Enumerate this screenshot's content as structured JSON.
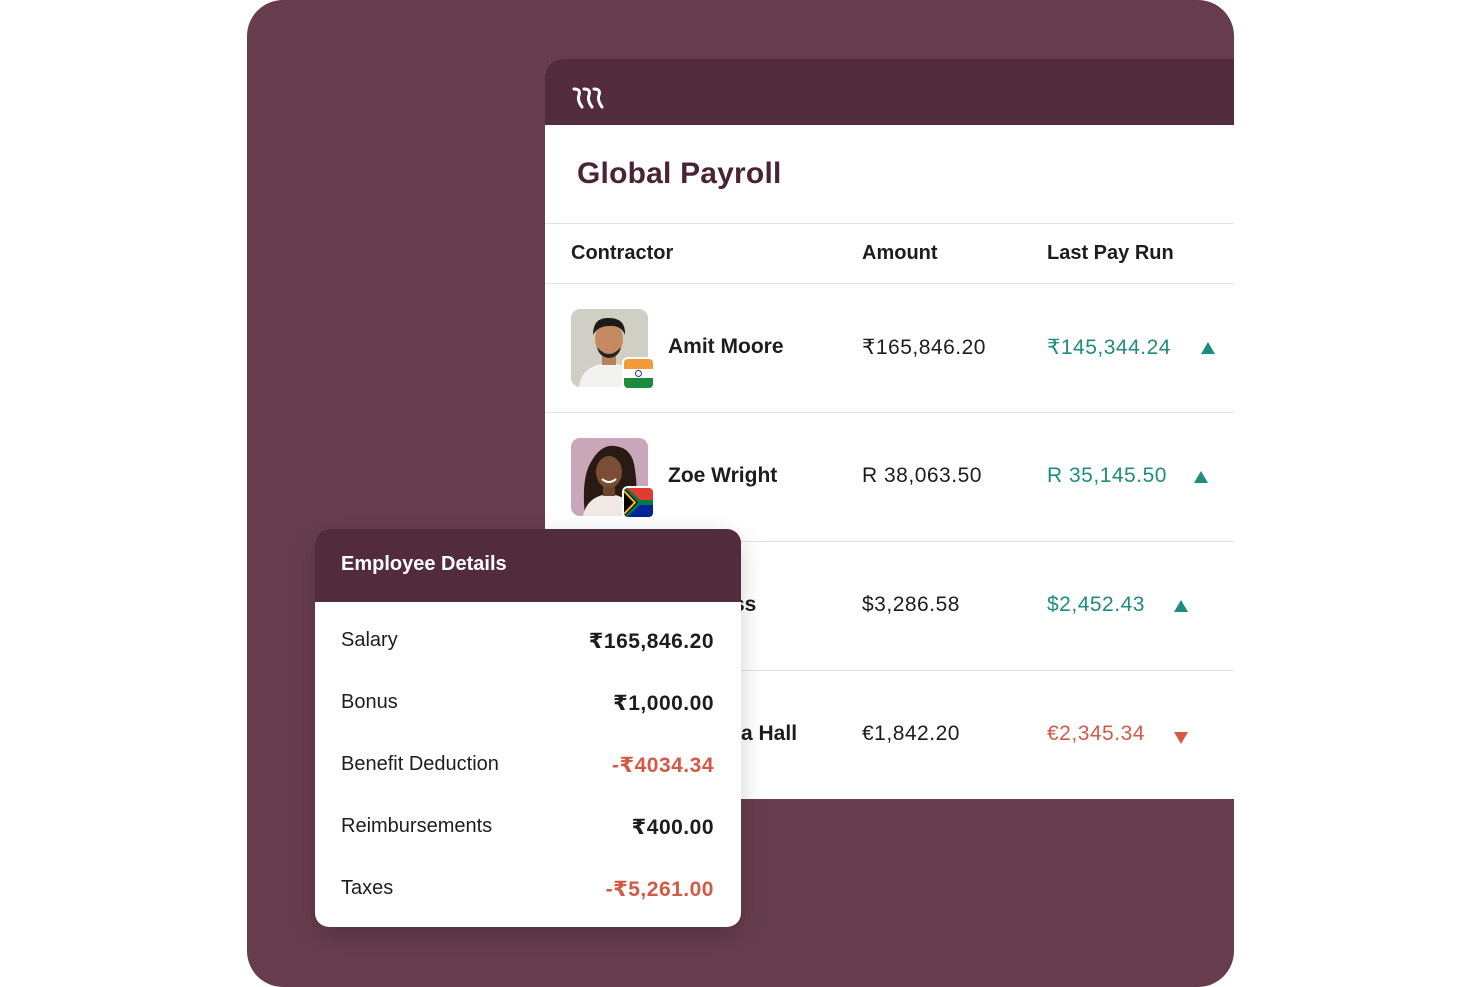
{
  "app": {
    "title": "Global Payroll"
  },
  "table": {
    "headers": {
      "contractor": "Contractor",
      "amount": "Amount",
      "last_pay_run": "Last Pay Run"
    },
    "rows": [
      {
        "name": "Amit Moore",
        "amount": "₹165,846.20",
        "last_pay_run": "₹145,344.24",
        "trend": "up",
        "flag": "india-flag"
      },
      {
        "name": "Zoe Wright",
        "amount": "R 38,063.50",
        "last_pay_run": "R 35,145.50",
        "trend": "up",
        "flag": "south-africa-flag"
      },
      {
        "name": "ss",
        "amount": "$3,286.58",
        "last_pay_run": "$2,452.43",
        "trend": "up"
      },
      {
        "name": "a Hall",
        "amount": "€1,842.20",
        "last_pay_run": "€2,345.34",
        "trend": "down"
      }
    ]
  },
  "employee_details": {
    "title": "Employee Details",
    "items": [
      {
        "label": "Salary",
        "value": "₹165,846.20",
        "negative": false
      },
      {
        "label": "Bonus",
        "value": "₹1,000.00",
        "negative": false
      },
      {
        "label": "Benefit Deduction",
        "value": "-₹4034.34",
        "negative": true
      },
      {
        "label": "Reimbursements",
        "value": "₹400.00",
        "negative": false
      },
      {
        "label": "Taxes",
        "value": "-₹5,261.00",
        "negative": true
      }
    ]
  },
  "colors": {
    "backdrop": "#673d4e",
    "header": "#522c3d",
    "title": "#4a2435",
    "up": "#1f8c80",
    "down": "#d45a46"
  }
}
